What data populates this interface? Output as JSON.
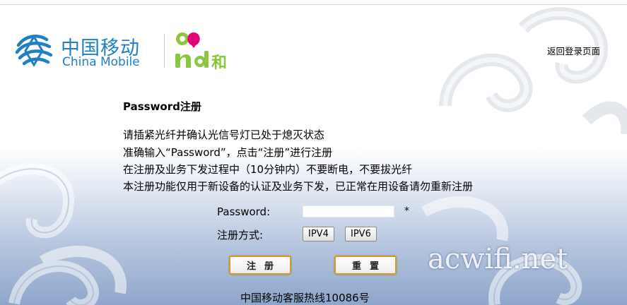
{
  "header": {
    "brand_cn": "中国移动",
    "brand_en": "China Mobile",
    "and_logo_text": "and和",
    "back_link": "返回登录页面"
  },
  "main": {
    "title": "Password注册",
    "instructions": [
      "请插紧光纤并确认光信号灯已处于熄灭状态",
      "准确输入“Password”，点击“注册”进行注册",
      "在注册及业务下发过程中（10分钟内）不要断电，不要拔光纤",
      "本注册功能仅用于新设备的认证及业务下发，已正常在用设备请勿重新注册"
    ],
    "password_label": "Password:",
    "password_value": "",
    "required_mark": "*",
    "mode_label": "注册方式:",
    "mode_options": [
      "IPV4",
      "IPV6"
    ],
    "register_button": "注册",
    "reset_button": "重置",
    "hotline": "中国移动客服热线10086号"
  },
  "watermark": "acwifi.net",
  "colors": {
    "brand_blue": "#1f7fc4",
    "and_green": "#8cc63f",
    "and_pink": "#e5007e",
    "button_border": "#d99a1a"
  },
  "icons": {
    "china_mobile_logo": "china-mobile-icon",
    "and_logo": "and-logo"
  }
}
